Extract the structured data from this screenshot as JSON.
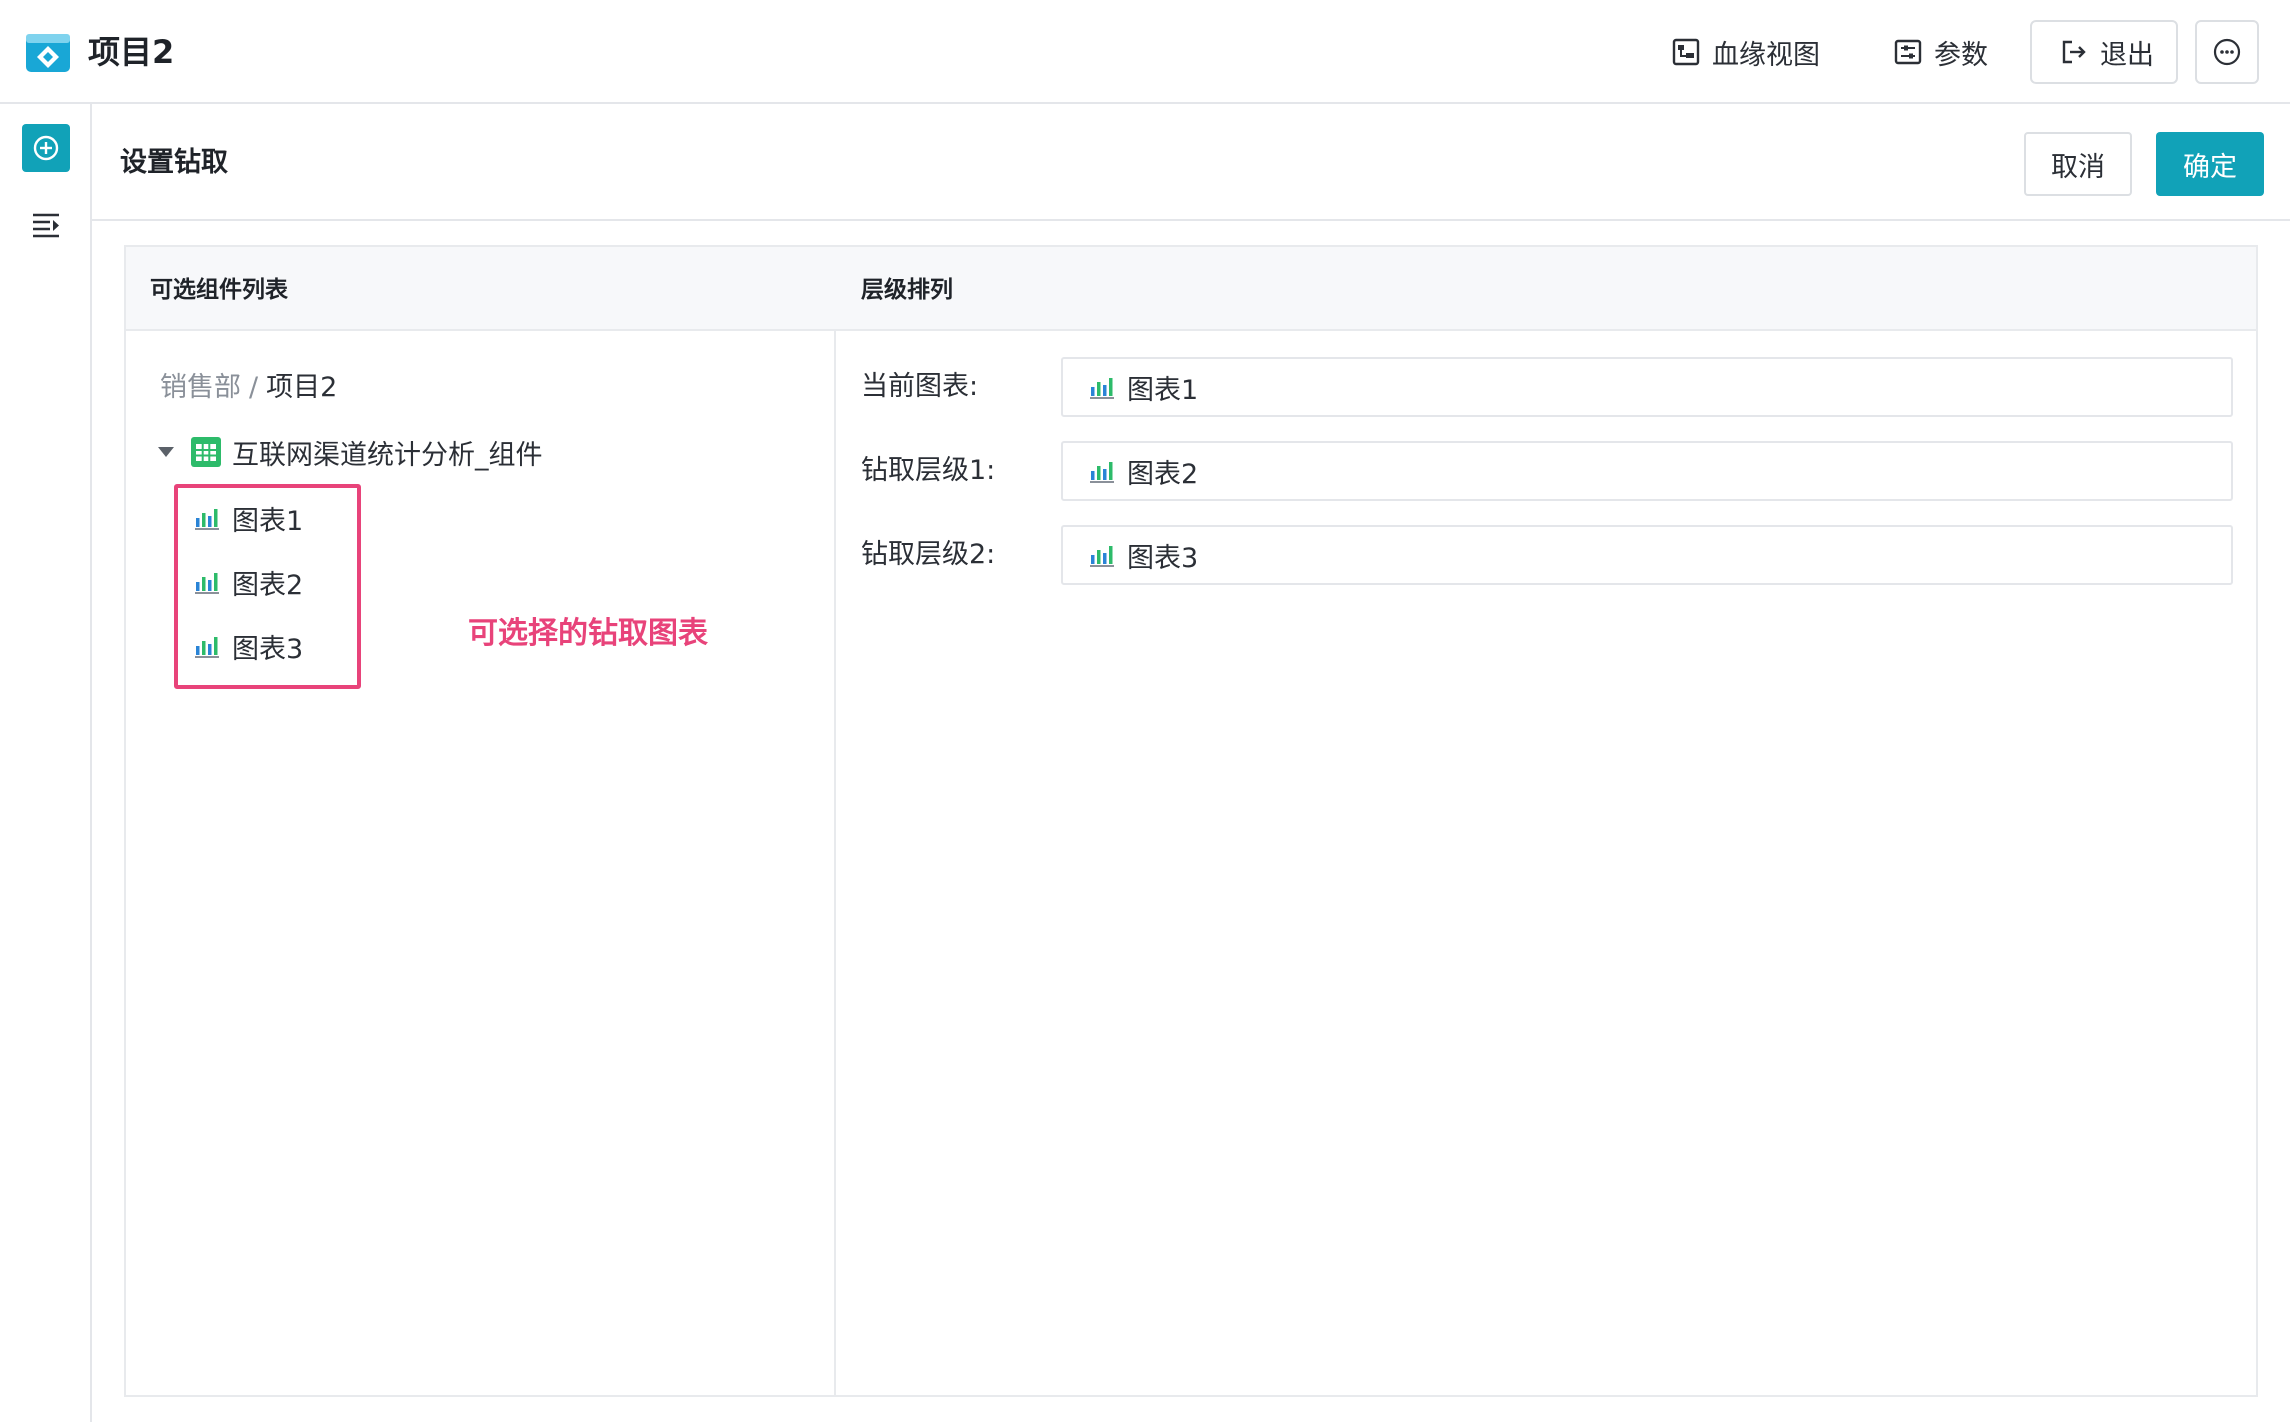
{
  "header": {
    "title": "项目2",
    "lineage_label": "血缘视图",
    "params_label": "参数",
    "exit_label": "退出"
  },
  "panel": {
    "title": "设置钻取",
    "cancel_label": "取消",
    "ok_label": "确定"
  },
  "left_column": {
    "title": "可选组件列表",
    "breadcrumb_root": "销售部",
    "breadcrumb_sep": "/",
    "breadcrumb_current": "项目2",
    "folder": "互联网渠道统计分析_组件",
    "items": [
      {
        "label": "图表1"
      },
      {
        "label": "图表2"
      },
      {
        "label": "图表3"
      }
    ],
    "annotation": "可选择的钻取图表"
  },
  "right_column": {
    "title": "层级排列",
    "levels": [
      {
        "label": "当前图表:",
        "value": "图表1"
      },
      {
        "label": "钻取层级1:",
        "value": "图表2"
      },
      {
        "label": "钻取层级2:",
        "value": "图表3"
      }
    ]
  },
  "colors": {
    "accent": "#11a2b8",
    "annotation": "#e8437a",
    "table_icon": "#2dbb6a"
  },
  "icons": [
    "app-logo-icon",
    "lineage-icon",
    "params-icon",
    "exit-icon",
    "more-icon",
    "add-icon",
    "outline-icon",
    "table-icon",
    "bar-chart-icon"
  ]
}
